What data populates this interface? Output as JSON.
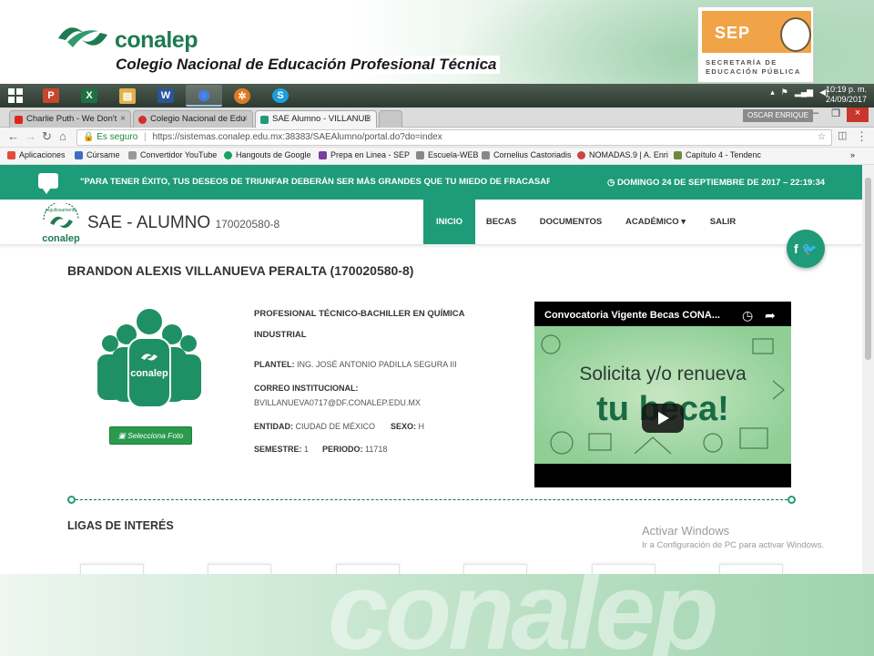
{
  "slide": {
    "brand": "conalep",
    "brand_full": "Colegio Nacional de Educación Profesional Técnica",
    "sep": {
      "acronym": "SEP",
      "line1": "SECRETARÍA DE",
      "line2": "EDUCACIÓN PÚBLICA"
    }
  },
  "taskbar": {
    "apps": [
      {
        "name": "powerpoint",
        "glyph": "P",
        "color": "#c8462b"
      },
      {
        "name": "excel",
        "glyph": "X",
        "color": "#1d7043"
      },
      {
        "name": "file-explorer",
        "glyph": "▤",
        "color": "#e2b24a"
      },
      {
        "name": "word",
        "glyph": "W",
        "color": "#2a5699"
      },
      {
        "name": "chrome",
        "glyph": "◉",
        "color": "#4285f4"
      },
      {
        "name": "settings",
        "glyph": "✲",
        "color": "#e07a22"
      },
      {
        "name": "skype",
        "glyph": "S",
        "color": "#1e9fdc"
      }
    ],
    "time": "10:19 p. m.",
    "date": "24/09/2017"
  },
  "browser": {
    "tabs": [
      {
        "label": "Charlie Puth - We Don't",
        "color": "#e0241b"
      },
      {
        "label": "Colegio Nacional de Edu",
        "color": "#d92b2b"
      },
      {
        "label": "SAE Alumno - VILLANUE",
        "color": "#1e9b78"
      }
    ],
    "profile": "OSCAR ENRIQUE",
    "secure_label": "Es seguro",
    "url": "https://sistemas.conalep.edu.mx:38383/SAEAlumno/portal.do?do=index",
    "bookmarks": [
      {
        "label": "Aplicaciones",
        "color": "#e14c3c"
      },
      {
        "label": "Cúrsame",
        "color": "#3b6ec7"
      },
      {
        "label": "Convertidor YouTube",
        "color": "#999999"
      },
      {
        "label": "Hangouts de Google",
        "color": "#1aa260"
      },
      {
        "label": "Prepa en Linea - SEP",
        "color": "#7a3f99"
      },
      {
        "label": "Escuela-WEB",
        "color": "#888888"
      },
      {
        "label": "Cornelius Castoriadis",
        "color": "#888888"
      },
      {
        "label": "NOMADAS.9 | A. Enri",
        "color": "#cc4444"
      },
      {
        "label": "Capítulo 4 - Tendenc",
        "color": "#6b8b3a"
      }
    ]
  },
  "page": {
    "quote": "\"PARA TENER ÉXITO, TUS DESEOS DE TRIUNFAR DEBERÁN SER MÁS GRANDES QUE TU MIEDO DE FRACASAR.\" (BILL C",
    "datetime": "DOMINGO 24 DE SEPTIEMBRE DE 2017 – 22:19:34",
    "logo_top": "orgullosamente",
    "logo_brand": "conalep",
    "title": "SAE - ALUMNO",
    "title_id": "170020580-8",
    "nav": [
      "INICIO",
      "BECAS",
      "DOCUMENTOS",
      "ACADÉMICO ▾",
      "SALIR"
    ],
    "social": "f 🐦",
    "student_name": "BRANDON ALEXIS VILLANUEVA PERALTA (170020580-8)",
    "photo_button": "Selecciona Foto",
    "career": "PROFESIONAL TÉCNICO-BACHILLER EN QUÍMICA INDUSTRIAL",
    "plantel_label": "PLANTEL:",
    "plantel": "ING. JOSÉ ANTONIO PADILLA SEGURA III",
    "correo_label": "CORREO INSTITUCIONAL:",
    "correo": "BVILLANUEVA0717@DF.CONALEP.EDU.MX",
    "entidad_label": "ENTIDAD:",
    "entidad": "CIUDAD DE MÉXICO",
    "sexo_label": "SEXO:",
    "sexo": "H",
    "semestre_label": "SEMESTRE:",
    "semestre": "1",
    "periodo_label": "PERIODO:",
    "periodo": "11718",
    "video_title": "Convocatoria Vigente Becas CONA...",
    "video_line1": "Solicita y/o renueva",
    "video_line2": "tu beca!",
    "ligas": "LIGAS DE INTERÉS",
    "activate_title": "Activar Windows",
    "activate_sub": "Ir a Configuración de PC para activar Windows."
  },
  "colors": {
    "accent": "#1e9b78",
    "dark_green": "#1e7a52",
    "sep_orange": "#f0a447"
  }
}
